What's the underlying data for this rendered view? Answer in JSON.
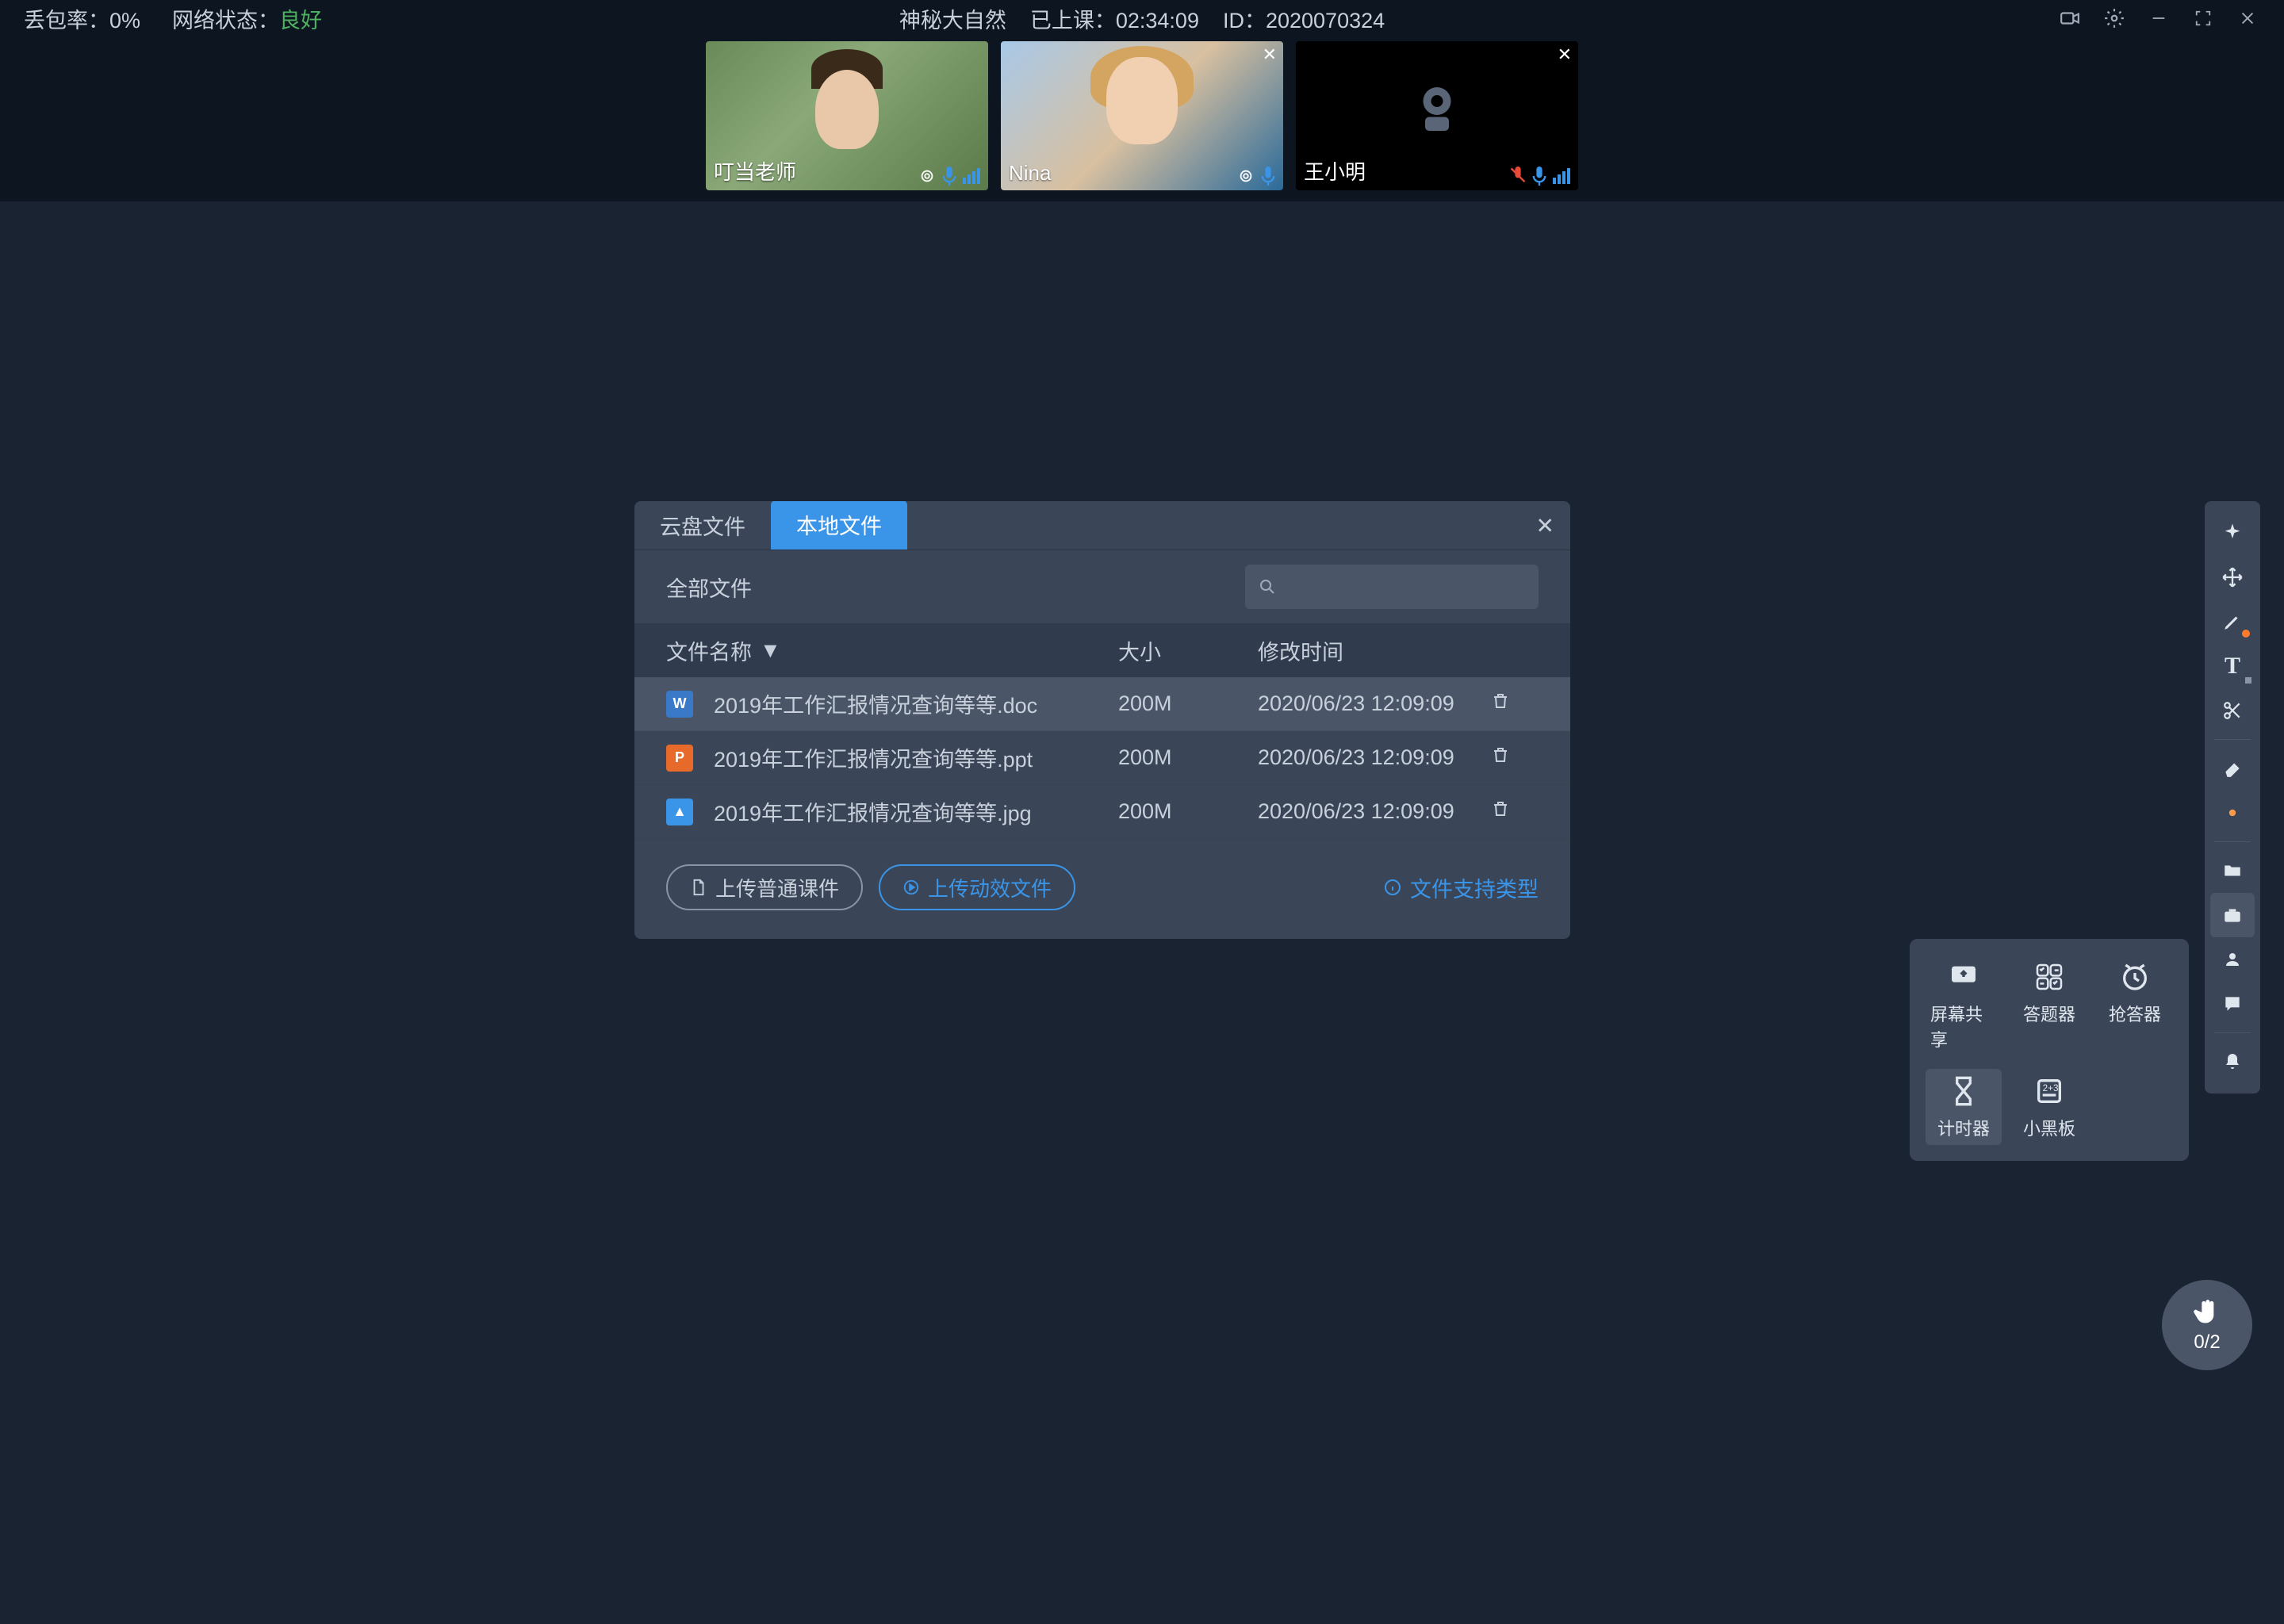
{
  "top": {
    "loss_label": "丢包率：",
    "loss_value": "0%",
    "net_label": "网络状态：",
    "net_value": "良好",
    "title": "神秘大自然",
    "elapsed_label": "已上课：",
    "elapsed_value": "02:34:09",
    "id_label": "ID：",
    "id_value": "2020070324"
  },
  "videos": {
    "p1": "叮当老师",
    "p2": "Nina",
    "p3": "王小明"
  },
  "dialog": {
    "tab_cloud": "云盘文件",
    "tab_local": "本地文件",
    "all_files": "全部文件",
    "col_name": "文件名称",
    "col_size": "大小",
    "col_time": "修改时间",
    "upload_normal": "上传普通课件",
    "upload_anim": "上传动效文件",
    "support": "文件支持类型"
  },
  "files": [
    {
      "icon": "W",
      "type": "doc",
      "name": "2019年工作汇报情况查询等等.doc",
      "size": "200M",
      "time": "2020/06/23 12:09:09"
    },
    {
      "icon": "P",
      "type": "ppt",
      "name": "2019年工作汇报情况查询等等.ppt",
      "size": "200M",
      "time": "2020/06/23 12:09:09"
    },
    {
      "icon": "▲",
      "type": "jpg",
      "name": "2019年工作汇报情况查询等等.jpg",
      "size": "200M",
      "time": "2020/06/23 12:09:09"
    }
  ],
  "panel": {
    "screen": "屏幕共享",
    "quiz": "答题器",
    "buzzer": "抢答器",
    "timer": "计时器",
    "board": "小黑板"
  },
  "hand": {
    "count": "0/2"
  }
}
